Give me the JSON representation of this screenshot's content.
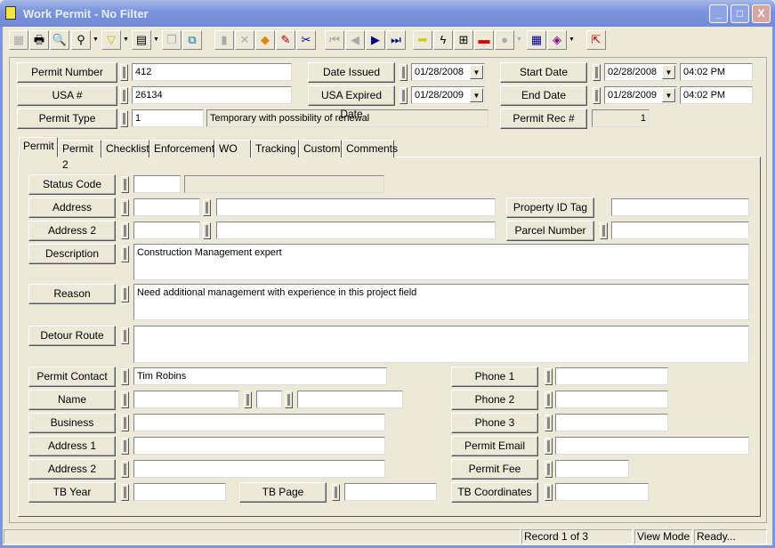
{
  "window": {
    "title": "Work Permit - No Filter",
    "controls": [
      "_",
      "□",
      "X"
    ]
  },
  "toolbar": {
    "icons": [
      "grid-icon",
      "print-icon",
      "preview-icon",
      "find-icon",
      "filter-icon",
      "report-icon",
      "copy-icon",
      "export-icon",
      "save-icon",
      "delete-icon",
      "stack-icon",
      "edit-icon",
      "cut-icon",
      "first-icon",
      "prev-icon",
      "next-icon",
      "last-icon",
      "go-icon",
      "lightning-icon",
      "tree-icon",
      "toolbox-icon",
      "globe-icon",
      "calculator-icon",
      "book-icon",
      "exit-icon"
    ]
  },
  "header": {
    "permit_number": {
      "label": "Permit Number",
      "value": "412"
    },
    "usa": {
      "label": "USA #",
      "value": "26134"
    },
    "permit_type": {
      "label": "Permit Type",
      "value": "1",
      "description": "Temporary with possibility of renewal"
    },
    "date_issued": {
      "label": "Date Issued",
      "value": "01/28/2008"
    },
    "usa_expired": {
      "label": "USA Expired Date",
      "value": "01/28/2009"
    },
    "start_date": {
      "label": "Start Date",
      "value": "02/28/2008",
      "time": "04:02 PM"
    },
    "end_date": {
      "label": "End Date",
      "value": "01/28/2009",
      "time": "04:02 PM"
    },
    "permit_rec": {
      "label": "Permit Rec #",
      "value": "1"
    }
  },
  "tabs": [
    "Permit",
    "Permit 2",
    "Checklist",
    "Enforcement",
    "WO",
    "Tracking",
    "Custom",
    "Comments"
  ],
  "form": {
    "status_code": "Status Code",
    "address": "Address",
    "address2": "Address 2",
    "description": "Description",
    "description_value": "Construction Management expert",
    "reason": "Reason",
    "reason_value": "Need additional management with experience in this project field",
    "detour_route": "Detour Route",
    "property_id_tag": "Property ID Tag",
    "parcel_number": "Parcel Number",
    "permit_contact": "Permit Contact",
    "permit_contact_value": "Tim Robins",
    "name": "Name",
    "business": "Business",
    "c_address1": "Address 1",
    "c_address2": "Address 2",
    "tb_year": "TB Year",
    "tb_page": "TB Page",
    "tb_coordinates": "TB Coordinates",
    "phone1": "Phone 1",
    "phone2": "Phone 2",
    "phone3": "Phone 3",
    "permit_email": "Permit Email",
    "permit_fee": "Permit Fee"
  },
  "status": {
    "record": "Record 1 of 3",
    "mode": "View Mode",
    "state": "Ready..."
  }
}
